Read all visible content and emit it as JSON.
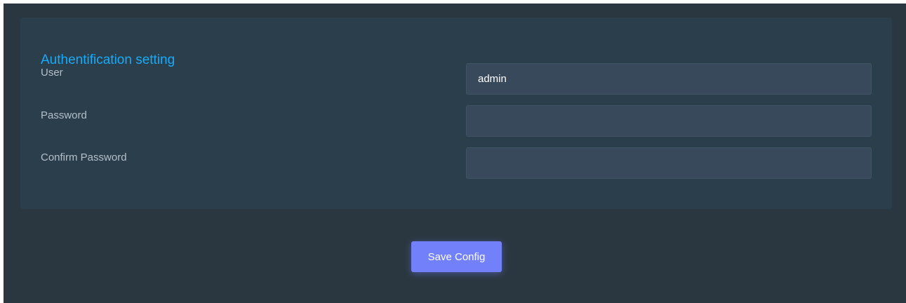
{
  "auth": {
    "title": "Authentification setting",
    "fields": [
      {
        "label": "User",
        "value": "admin",
        "type": "text"
      },
      {
        "label": "Password",
        "value": "",
        "type": "password"
      },
      {
        "label": "Confirm Password",
        "value": "",
        "type": "password"
      }
    ]
  },
  "actions": {
    "save_label": "Save Config"
  },
  "colors": {
    "background": "#2b3740",
    "card": "#2b3e4b",
    "title": "#19aaf8",
    "input": "#37495a",
    "button": "#7280fa"
  }
}
